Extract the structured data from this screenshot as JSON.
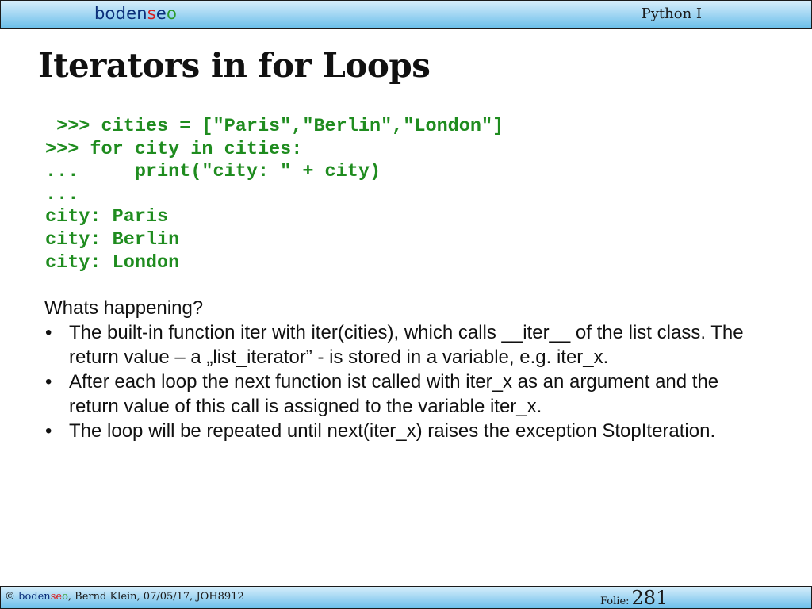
{
  "header": {
    "logo": {
      "part1": "boden",
      "part2": "s",
      "part3": "e",
      "part4": "o"
    },
    "course_title": "Python I"
  },
  "slide": {
    "title": "Iterators in for Loops",
    "code_lines": [
      " >>> cities = [\"Paris\",\"Berlin\",\"London\"]",
      ">>> for city in cities:",
      "...     print(\"city: \" + city)",
      "...",
      "city: Paris",
      "city: Berlin",
      "city: London"
    ],
    "explanation_heading": "Whats happening?",
    "bullets": [
      "The built-in function iter with iter(cities), which calls __iter__ of the list class.  The return value  – a „list_iterator” - is stored in a variable, e.g. iter_x.",
      "After each loop the next function ist called with iter_x as an argument and the return value of this call is assigned to the variable iter_x.",
      "The loop will be repeated until next(iter_x) raises the exception StopIteration."
    ],
    "bullet_symbol": "•"
  },
  "footer": {
    "copyright_symbol": "© ",
    "brand": {
      "part1": "boden",
      "part2": "se",
      "part3": "o"
    },
    "author_info": ", Bernd Klein, 07/05/17, JOH8912",
    "folie_label": "Folie:",
    "folie_number": "281"
  },
  "colors": {
    "code_green": "#1f8c1f",
    "header_gradient_top": "#d6eefb",
    "header_gradient_bottom": "#6cc0ea",
    "logo_blue": "#0b2f7a",
    "logo_red": "#d81e1e",
    "logo_green": "#2a9a2a"
  }
}
